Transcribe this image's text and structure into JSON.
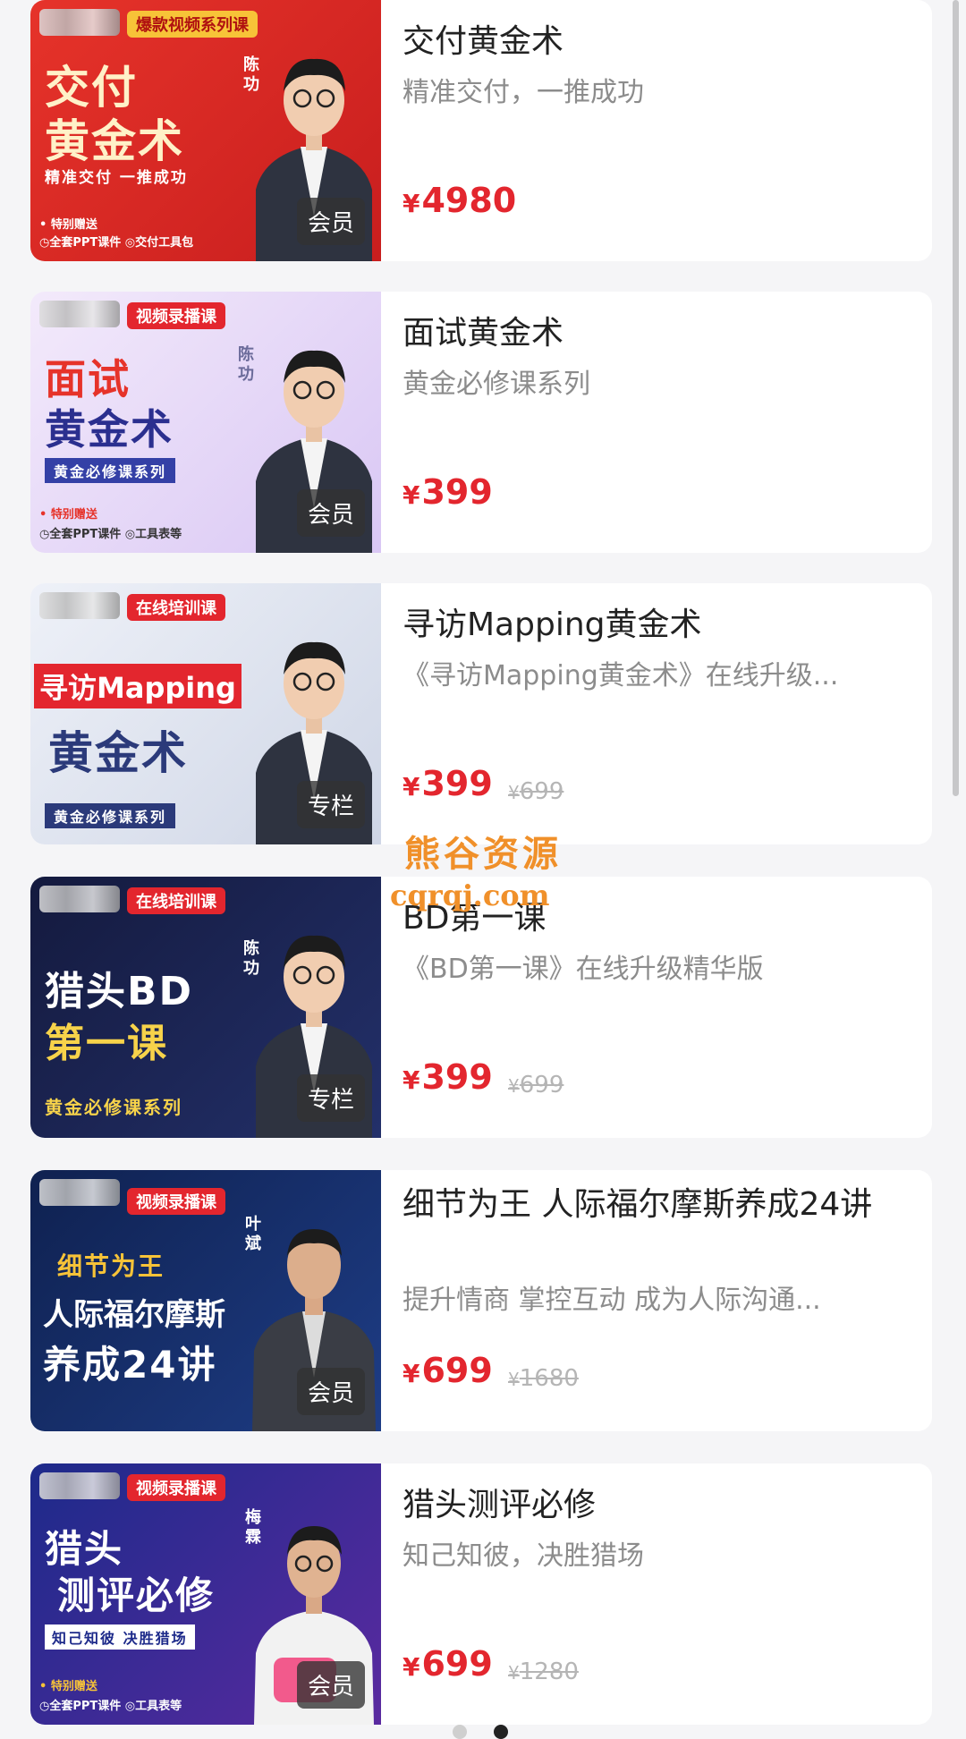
{
  "courses": [
    {
      "title": "交付黄金术",
      "description": "精准交付，一推成功",
      "price": "4980",
      "original_price": "",
      "badge": "会员",
      "thumb_tag": "爆款视频系列课",
      "thumb_line1": "交付",
      "thumb_line2": "黄金术",
      "thumb_sub": "精准交付 一推成功",
      "thumb_strip1": "• 特别赠送",
      "thumb_strip2": "◷全套PPT课件 ◎交付工具包",
      "teacher": "陈功"
    },
    {
      "title": "面试黄金术",
      "description": "黄金必修课系列",
      "price": "399",
      "original_price": "",
      "badge": "会员",
      "thumb_tag": "视频录播课",
      "thumb_line1": "面试",
      "thumb_line2": "黄金术",
      "thumb_sub": "黄金必修课系列",
      "thumb_strip1": "• 特别赠送",
      "thumb_strip2": "◷全套PPT课件 ◎工具表等",
      "teacher": "陈功"
    },
    {
      "title": "寻访Mapping黄金术",
      "description": "《寻访Mapping黄金术》在线升级...",
      "price": "399",
      "original_price": "699",
      "badge": "专栏",
      "thumb_tag": "在线培训课",
      "thumb_line1": "寻访Mapping",
      "thumb_line2": "黄金术",
      "thumb_sub": "黄金必修课系列",
      "thumb_strip1": "",
      "thumb_strip2": "",
      "teacher": ""
    },
    {
      "title": "BD第一课",
      "description": "《BD第一课》在线升级精华版",
      "price": "399",
      "original_price": "699",
      "badge": "专栏",
      "thumb_tag": "在线培训课",
      "thumb_line1": "猎头BD",
      "thumb_line2": "第一课",
      "thumb_sub": "黄金必修课系列",
      "thumb_strip1": "",
      "thumb_strip2": "",
      "teacher": "陈功"
    },
    {
      "title": "细节为王 人际福尔摩斯养成24讲",
      "description": "提升情商 掌控互动 成为人际沟通...",
      "price": "699",
      "original_price": "1680",
      "badge": "会员",
      "thumb_tag": "视频录播课",
      "thumb_line1": "细节为王",
      "thumb_line2": "人际福尔摩斯",
      "thumb_line3": "养成24讲",
      "thumb_sub": "",
      "thumb_strip1": "",
      "thumb_strip2": "",
      "teacher": "叶斌"
    },
    {
      "title": "猎头测评必修",
      "description": "知己知彼，决胜猎场",
      "price": "699",
      "original_price": "1280",
      "badge": "会员",
      "thumb_tag": "视频录播课",
      "thumb_line1": "猎头",
      "thumb_line2": "测评必修",
      "thumb_sub": "知己知彼 决胜猎场",
      "thumb_strip1": "• 特别赠送",
      "thumb_strip2": "◷全套PPT课件 ◎工具表等",
      "teacher": "梅霖"
    }
  ],
  "currency_symbol": "¥",
  "watermark": {
    "line1": "熊谷资源",
    "line2": "cqrqj.com"
  },
  "colors": {
    "price": "#e3262e",
    "watermark": "#f0902a"
  }
}
